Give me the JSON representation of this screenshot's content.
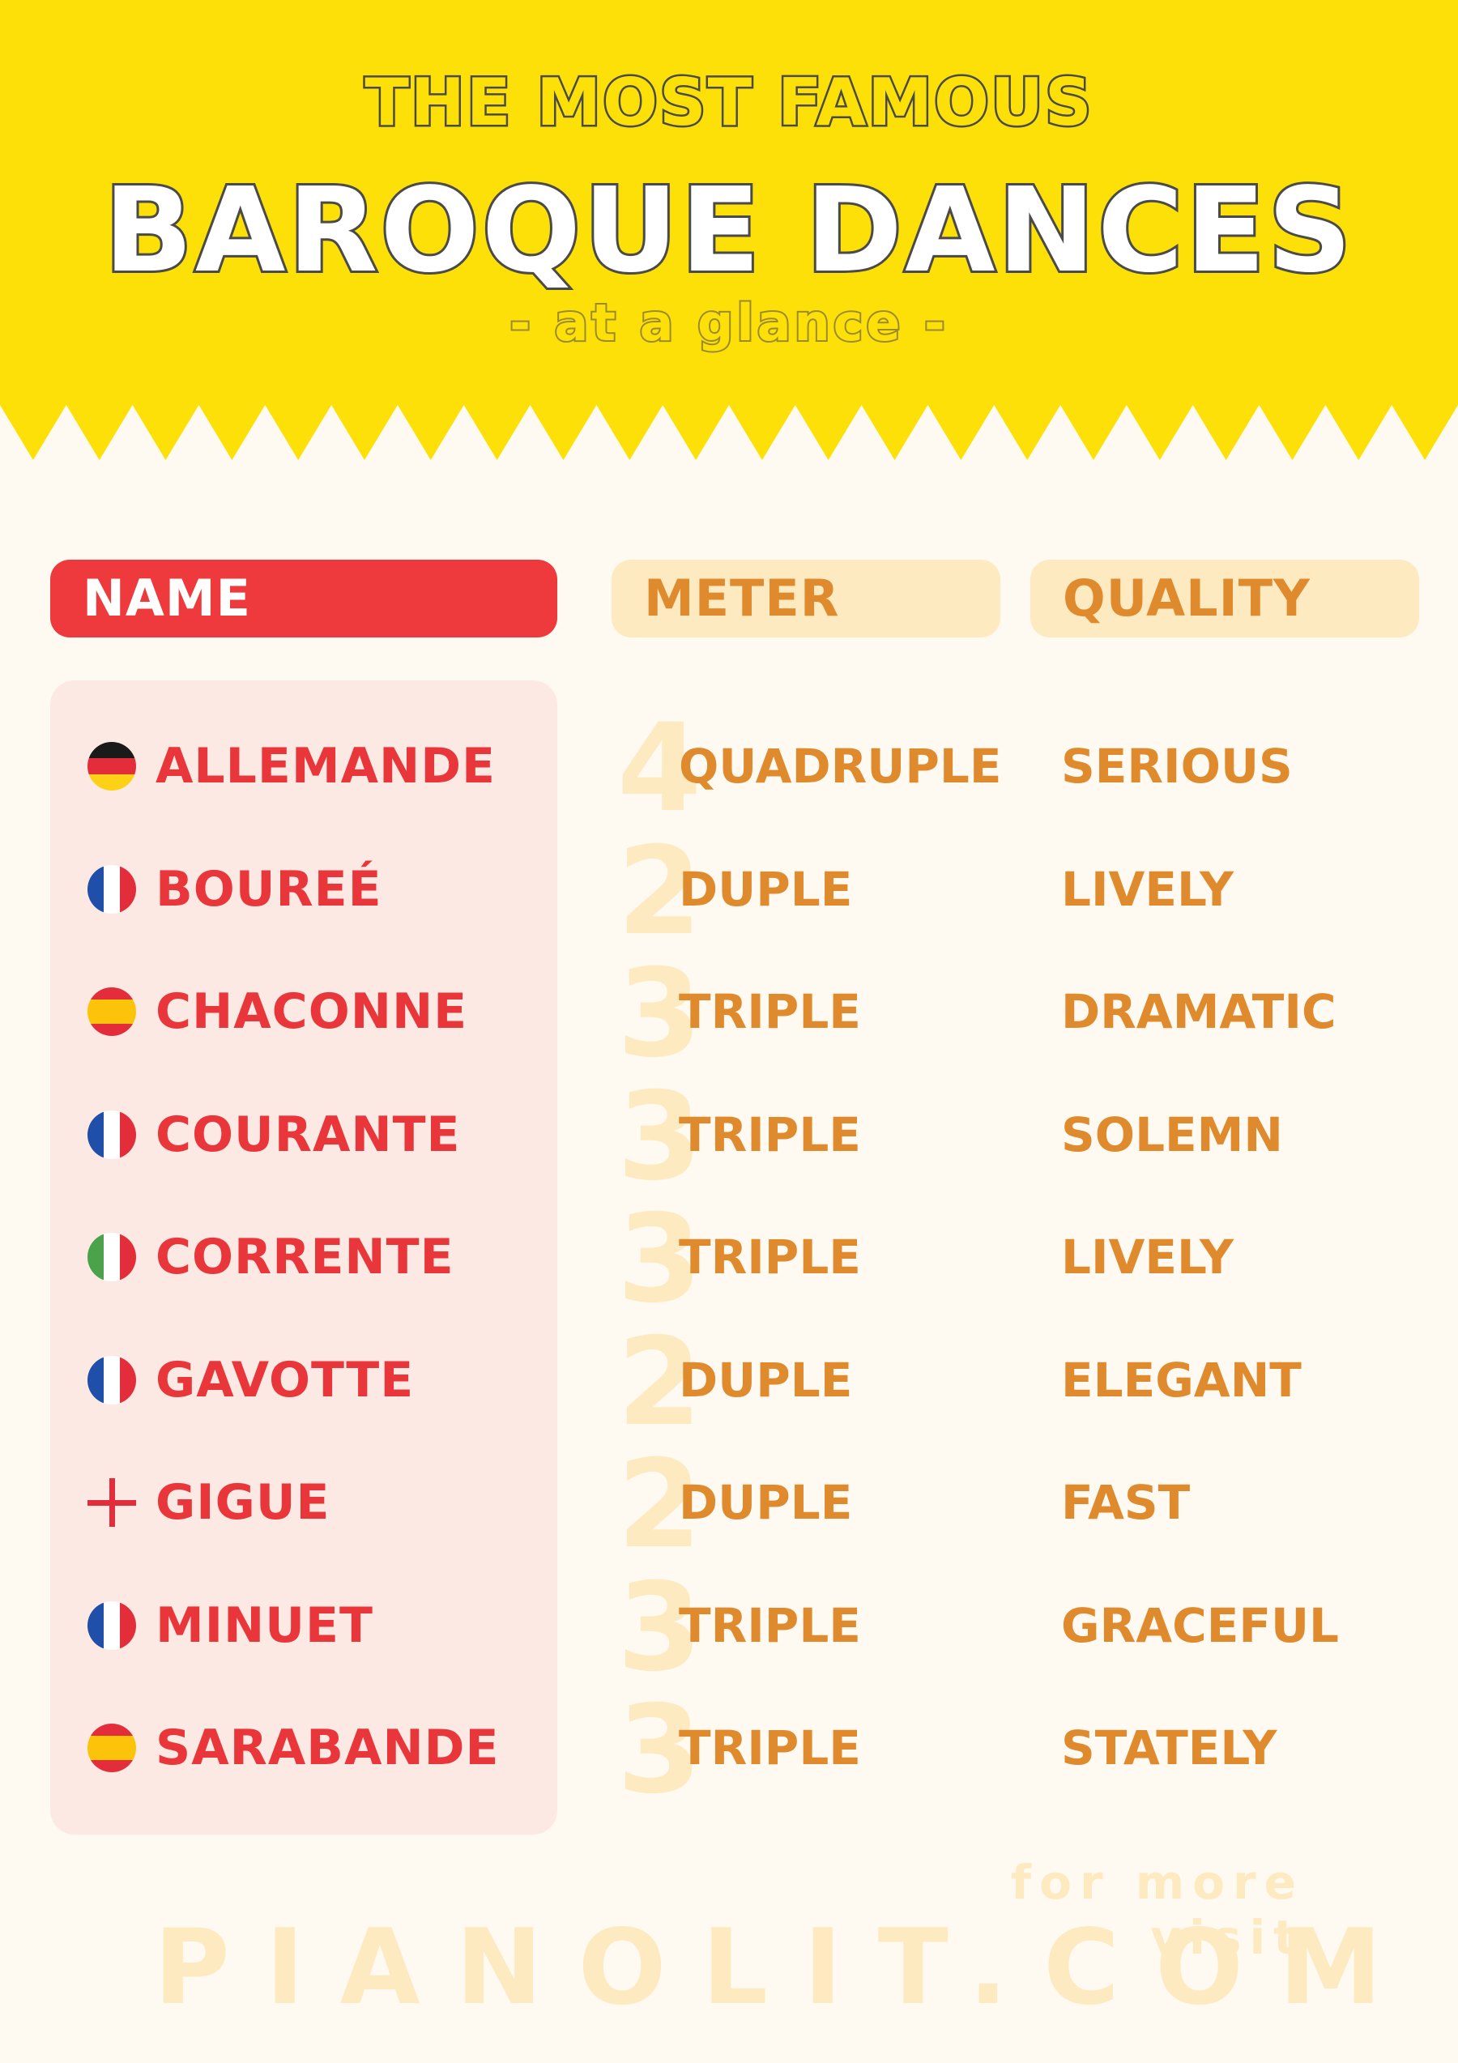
{
  "header": {
    "line1": "THE MOST FAMOUS",
    "line2": "BAROQUE DANCES",
    "line3": "- at a glance -"
  },
  "columns": {
    "name": "NAME",
    "meter": "METER",
    "quality": "QUALITY"
  },
  "dances": [
    {
      "name": "ALLEMANDE",
      "flag": "germany-flag-icon",
      "beats": "4",
      "meter": "QUADRUPLE",
      "quality": "SERIOUS"
    },
    {
      "name": "BOUREÉ",
      "flag": "france-flag-icon",
      "beats": "2",
      "meter": "DUPLE",
      "quality": "LIVELY"
    },
    {
      "name": "CHACONNE",
      "flag": "spain-flag-icon",
      "beats": "3",
      "meter": "TRIPLE",
      "quality": "DRAMATIC"
    },
    {
      "name": "COURANTE",
      "flag": "france-flag-icon",
      "beats": "3",
      "meter": "TRIPLE",
      "quality": "SOLEMN"
    },
    {
      "name": "CORRENTE",
      "flag": "italy-flag-icon",
      "beats": "3",
      "meter": "TRIPLE",
      "quality": "LIVELY"
    },
    {
      "name": "GAVOTTE",
      "flag": "france-flag-icon",
      "beats": "2",
      "meter": "DUPLE",
      "quality": "ELEGANT"
    },
    {
      "name": "GIGUE",
      "flag": "england-flag-icon",
      "beats": "2",
      "meter": "DUPLE",
      "quality": "FAST"
    },
    {
      "name": "MINUET",
      "flag": "france-flag-icon",
      "beats": "3",
      "meter": "TRIPLE",
      "quality": "GRACEFUL"
    },
    {
      "name": "SARABANDE",
      "flag": "spain-flag-icon",
      "beats": "3",
      "meter": "TRIPLE",
      "quality": "STATELY"
    }
  ],
  "footer": {
    "small": "for more visit",
    "big": "PIANOLIT.COM"
  },
  "colors": {
    "header_yellow": "#fce007",
    "background": "#fefaf2",
    "name_red": "#ee3a3c",
    "orange_text": "#e08a2e",
    "pale_orange": "#feeac0",
    "panel_pink": "#fde9e3"
  }
}
